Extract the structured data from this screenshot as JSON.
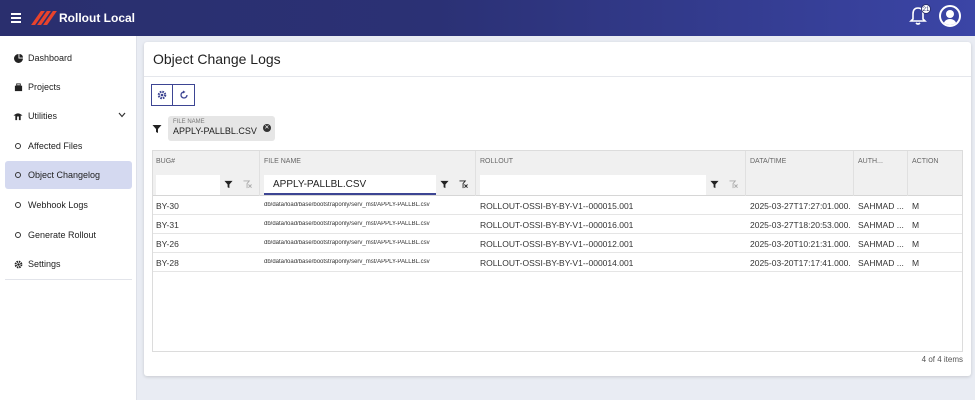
{
  "app": {
    "title": "Rollout Local",
    "notification_count": "21"
  },
  "sidebar": {
    "items": [
      {
        "label": "Dashboard"
      },
      {
        "label": "Projects"
      },
      {
        "label": "Utilities"
      },
      {
        "label": "Affected Files"
      },
      {
        "label": "Object Changelog"
      },
      {
        "label": "Webhook Logs"
      },
      {
        "label": "Generate Rollout"
      },
      {
        "label": "Settings"
      }
    ]
  },
  "page": {
    "title": "Object Change Logs"
  },
  "filter_chip": {
    "label": "FILE NAME",
    "value": "APPLY-PALLBL.CSV"
  },
  "grid": {
    "columns": [
      "BUG#",
      "FILE NAME",
      "ROLLOUT",
      "DATA/TIME",
      "AUTH...",
      "ACTION"
    ],
    "filters": {
      "bug": "",
      "file_name": "APPLY-PALLBL.CSV",
      "rollout": ""
    },
    "rows": [
      {
        "bug": "BY-30",
        "file": "db/data/load/base/bootstraponly/serv_mst/APPLY-PALLBL.csv",
        "rollout": "ROLLOUT-OSSI-BY-BY-V1--000015.001",
        "datetime": "2025-03-27T17:27:01.000...",
        "author": "SAHMAD ...",
        "action": "M"
      },
      {
        "bug": "BY-31",
        "file": "db/data/load/base/bootstraponly/serv_mst/APPLY-PALLBL.csv",
        "rollout": "ROLLOUT-OSSI-BY-BY-V1--000016.001",
        "datetime": "2025-03-27T18:20:53.000...",
        "author": "SAHMAD ...",
        "action": "M"
      },
      {
        "bug": "BY-26",
        "file": "db/data/load/base/bootstraponly/serv_mst/APPLY-PALLBL.csv",
        "rollout": "ROLLOUT-OSSI-BY-BY-V1--000012.001",
        "datetime": "2025-03-20T10:21:31.000...",
        "author": "SAHMAD ...",
        "action": "M"
      },
      {
        "bug": "BY-28",
        "file": "db/data/load/base/bootstraponly/serv_mst/APPLY-PALLBL.csv",
        "rollout": "ROLLOUT-OSSI-BY-BY-V1--000014.001",
        "datetime": "2025-03-20T17:17:41.000...",
        "author": "SAHMAD ...",
        "action": "M"
      }
    ],
    "footer": "4 of 4 items"
  },
  "colors": {
    "topbar": "#2b3175",
    "accent": "#3d4593",
    "logo": "#e8432c",
    "active_nav": "#d4d9f0"
  },
  "icons": [
    "menu-icon",
    "logo-icon",
    "bell-icon",
    "user-avatar-icon",
    "dashboard-icon",
    "projects-icon",
    "utilities-icon",
    "chevron-down-icon",
    "circle-icon",
    "settings-icon",
    "gear-icon",
    "refresh-icon",
    "filter-icon",
    "close-icon",
    "clear-filter-icon"
  ]
}
